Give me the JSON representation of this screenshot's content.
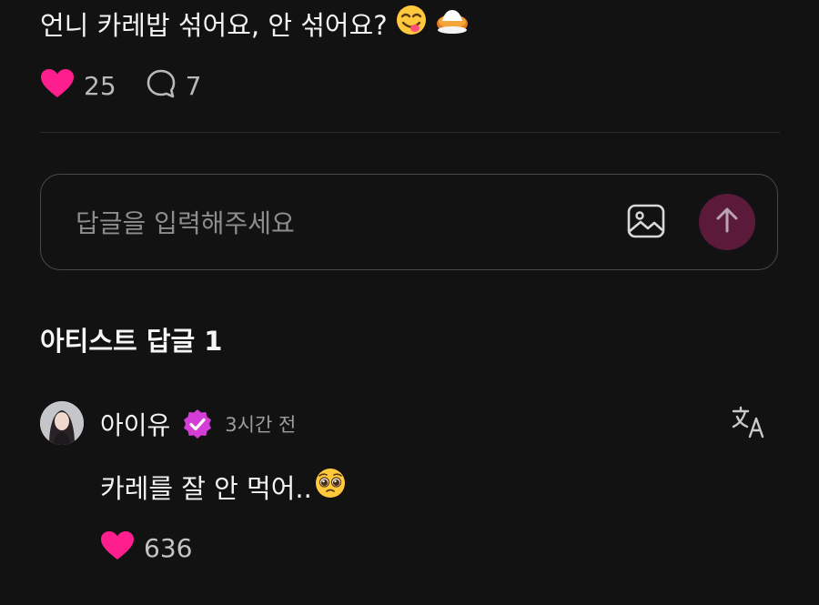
{
  "post": {
    "text": "언니 카레밥 섞어요, 안 섞어요?",
    "likes": "25",
    "comments": "7"
  },
  "reply_box": {
    "placeholder": "답글을 입력해주세요"
  },
  "artist_replies": {
    "title": "아티스트 답글 1",
    "items": [
      {
        "name": "아이유",
        "time": "3시간 전",
        "text": "카레를 잘 안 먹어..",
        "likes": "636"
      }
    ]
  },
  "colors": {
    "background": "#131213",
    "heart": "#ff1e8e",
    "verified": "#d43dd6",
    "send_button": "#5b1a3a"
  },
  "icons": [
    "yum-face-emoji",
    "curry-rice-emoji",
    "heart-icon",
    "comment-icon",
    "image-icon",
    "arrow-up-icon",
    "verified-badge-icon",
    "translate-icon",
    "pleading-face-emoji"
  ]
}
